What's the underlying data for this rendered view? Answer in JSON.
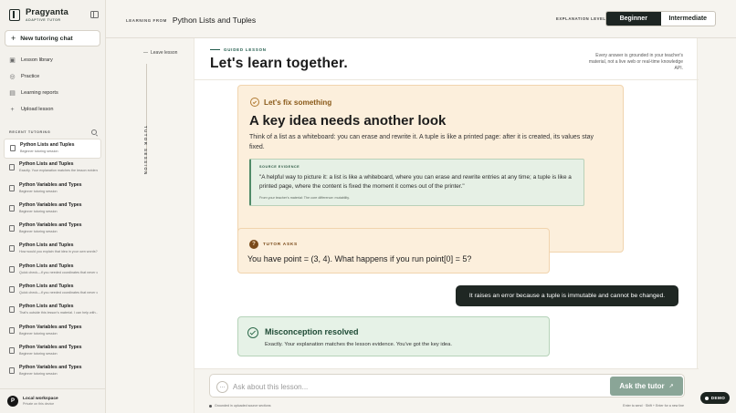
{
  "brand": {
    "name": "Pragyanta",
    "tagline": "ADAPTIVE TUTOR"
  },
  "sidebar": {
    "new_chat_label": "New tutoring chat",
    "nav": [
      {
        "label": "Lesson library",
        "icon": "book-icon"
      },
      {
        "label": "Practice",
        "icon": "target-icon"
      },
      {
        "label": "Learning reports",
        "icon": "bar-chart-icon"
      },
      {
        "label": "Upload lesson",
        "icon": "plus-icon"
      }
    ],
    "recent_label": "RECENT TUTORING",
    "recent": [
      {
        "title": "Python Lists and Tuples",
        "subtitle": "Beginner tutoring session"
      },
      {
        "title": "Python Lists and Tuples",
        "subtitle": "Exactly. Your explanation matches the lesson evidence."
      },
      {
        "title": "Python Variables and Types",
        "subtitle": "Beginner tutoring session"
      },
      {
        "title": "Python Variables and Types",
        "subtitle": "Beginner tutoring session"
      },
      {
        "title": "Python Variables and Types",
        "subtitle": "Beginner tutoring session"
      },
      {
        "title": "Python Lists and Tuples",
        "subtitle": "How would you explain that idea in your own words?"
      },
      {
        "title": "Python Lists and Tuples",
        "subtitle": "Quick check—if you needed coordinates that never change..."
      },
      {
        "title": "Python Lists and Tuples",
        "subtitle": "Quick check—if you needed coordinates that never change..."
      },
      {
        "title": "Python Lists and Tuples",
        "subtitle": "That's outside this lesson's material. I can help with..."
      },
      {
        "title": "Python Variables and Types",
        "subtitle": "Beginner tutoring session"
      },
      {
        "title": "Python Variables and Types",
        "subtitle": "Beginner tutoring session"
      },
      {
        "title": "Python Variables and Types",
        "subtitle": "Beginner tutoring session"
      }
    ],
    "workspace": {
      "avatar": "P",
      "title": "Local workspace",
      "subtitle": "Private on this device"
    }
  },
  "topbar": {
    "learning_from_label": "LEARNING FROM",
    "lesson_title": "Python Lists and Tuples",
    "explanation_level_label": "EXPLANATION LEVEL",
    "levels": [
      "Beginner",
      "Intermediate"
    ],
    "selected_level": "Beginner"
  },
  "rail": {
    "leave_label": "Leave lesson",
    "vertical_label": "TUTOR SESSION"
  },
  "main": {
    "guided_label": "GUIDED LESSON",
    "hero_title": "Let's learn together.",
    "grounded_note": "Every answer is grounded in your teacher's material, not a live web or real-time knowledge API.",
    "fix_card": {
      "label": "Let's fix something",
      "title": "A key idea needs another look",
      "body": "Think of a list as a whiteboard: you can erase and rewrite it. A tuple is like a printed page: after it is created, its values stay fixed.",
      "evidence_label": "SOURCE EVIDENCE",
      "evidence_quote": "\"A helpful way to picture it: a list is like a whiteboard, where you can erase and rewrite entries at any time; a tuple is like a printed page, where the content is fixed the moment it comes out of the printer.\"",
      "evidence_cite": "From your teacher's material: The core difference: mutability."
    },
    "ask_card": {
      "label": "TUTOR ASKS",
      "badge": "?",
      "question": "You have point = (3, 4). What happens if you run point[0] = 5?"
    },
    "user_reply": "It raises an error because a tuple is immutable and cannot be changed.",
    "resolved_card": {
      "title": "Misconception resolved",
      "body": "Exactly. Your explanation matches the lesson evidence. You've got the key idea."
    }
  },
  "composer": {
    "attach_glyph": "…",
    "placeholder": "Ask about this lesson...",
    "ask_button": "Ask the tutor",
    "grounded_footer": "Grounded in uploaded source sections",
    "keys_hint": "Enter to send · Shift + Enter for a new line"
  },
  "demo_badge": "DEMO",
  "colors": {
    "accent_dark": "#1d2522",
    "warning_bg": "#fcefdc",
    "success_bg": "#e6f2e7",
    "ask_button": "#8aa597"
  }
}
